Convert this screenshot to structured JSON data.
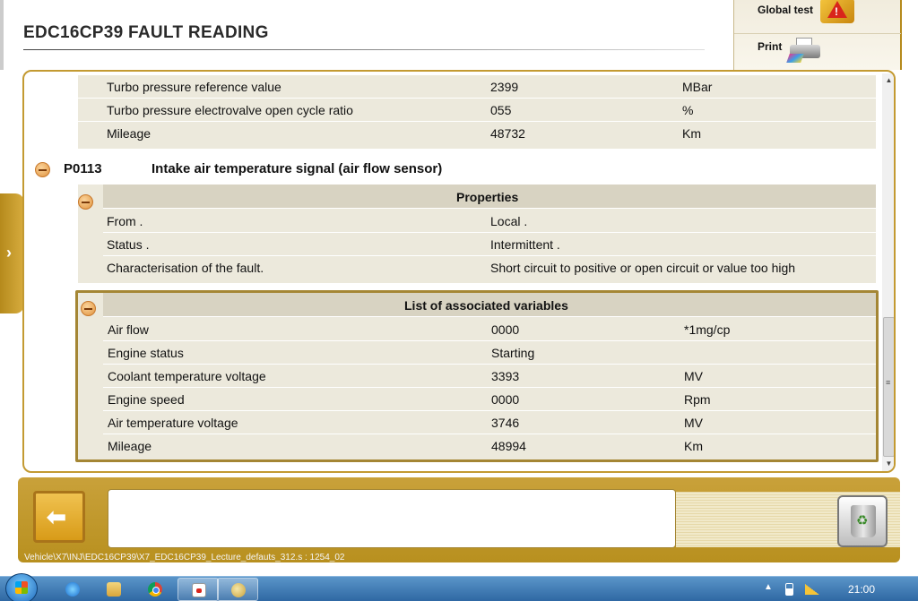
{
  "header": {
    "title": "EDC16CP39  FAULT READING",
    "global_test_label": "Global test",
    "print_label": "Print"
  },
  "top_table": {
    "rows": [
      {
        "name": "Turbo pressure reference value",
        "value": "2399",
        "unit": "MBar"
      },
      {
        "name": "Turbo pressure electrovalve open cycle ratio",
        "value": "055",
        "unit": "%"
      },
      {
        "name": "Mileage",
        "value": "48732",
        "unit": "Km"
      }
    ]
  },
  "fault": {
    "code": "P0113",
    "description": "Intake air temperature signal (air flow sensor)"
  },
  "properties": {
    "title": "Properties",
    "rows": [
      {
        "name": "From .",
        "value": "Local ."
      },
      {
        "name": "Status .",
        "value": "Intermittent ."
      },
      {
        "name": "Characterisation of the fault.",
        "value": "Short circuit to positive or open circuit or value too high"
      }
    ]
  },
  "variables": {
    "title": "List of associated variables",
    "rows": [
      {
        "name": "Air flow",
        "value": "0000",
        "unit": "*1mg/cp"
      },
      {
        "name": "Engine status",
        "value": "Starting",
        "unit": ""
      },
      {
        "name": "Coolant temperature voltage",
        "value": "3393",
        "unit": "MV"
      },
      {
        "name": "Engine speed",
        "value": "0000",
        "unit": "Rpm"
      },
      {
        "name": "Air temperature voltage",
        "value": "3746",
        "unit": "MV"
      },
      {
        "name": "Mileage",
        "value": "48994",
        "unit": "Km"
      }
    ]
  },
  "footer": {
    "path": "Vehicle\\X7\\INJ\\EDC16CP39\\X7_EDC16CP39_Lecture_defauts_312.s : 1254_02",
    "message": ""
  },
  "taskbar": {
    "clock": "21:00"
  },
  "icons": {
    "side_tab": "chevron-right-icon",
    "back": "back-arrow-icon",
    "trash": "recycle-bin-icon",
    "global_test": "warning-icon",
    "print": "printer-icon"
  },
  "colors": {
    "accent": "#c39a32",
    "row_background": "#ece9dc",
    "header_bar": "#d8d3c2",
    "collapse_icon": "#e0933f"
  }
}
